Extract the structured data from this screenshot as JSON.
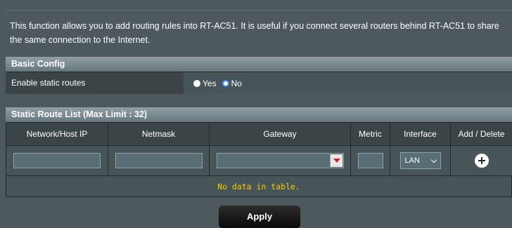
{
  "intro_text": "This function allows you to add routing rules into RT-AC51. It is useful if you connect several routers behind RT-AC51 to share the same connection to the Internet.",
  "basic_config": {
    "title": "Basic Config",
    "enable_label": "Enable static routes",
    "options": [
      "Yes",
      "No"
    ],
    "selected": "No"
  },
  "route_list": {
    "title": "Static Route List (Max Limit : 32)",
    "columns": [
      "Network/Host IP",
      "Netmask",
      "Gateway",
      "Metric",
      "Interface",
      "Add / Delete"
    ],
    "interface_value": "LAN",
    "empty_text": "No data in table."
  },
  "apply_label": "Apply"
}
